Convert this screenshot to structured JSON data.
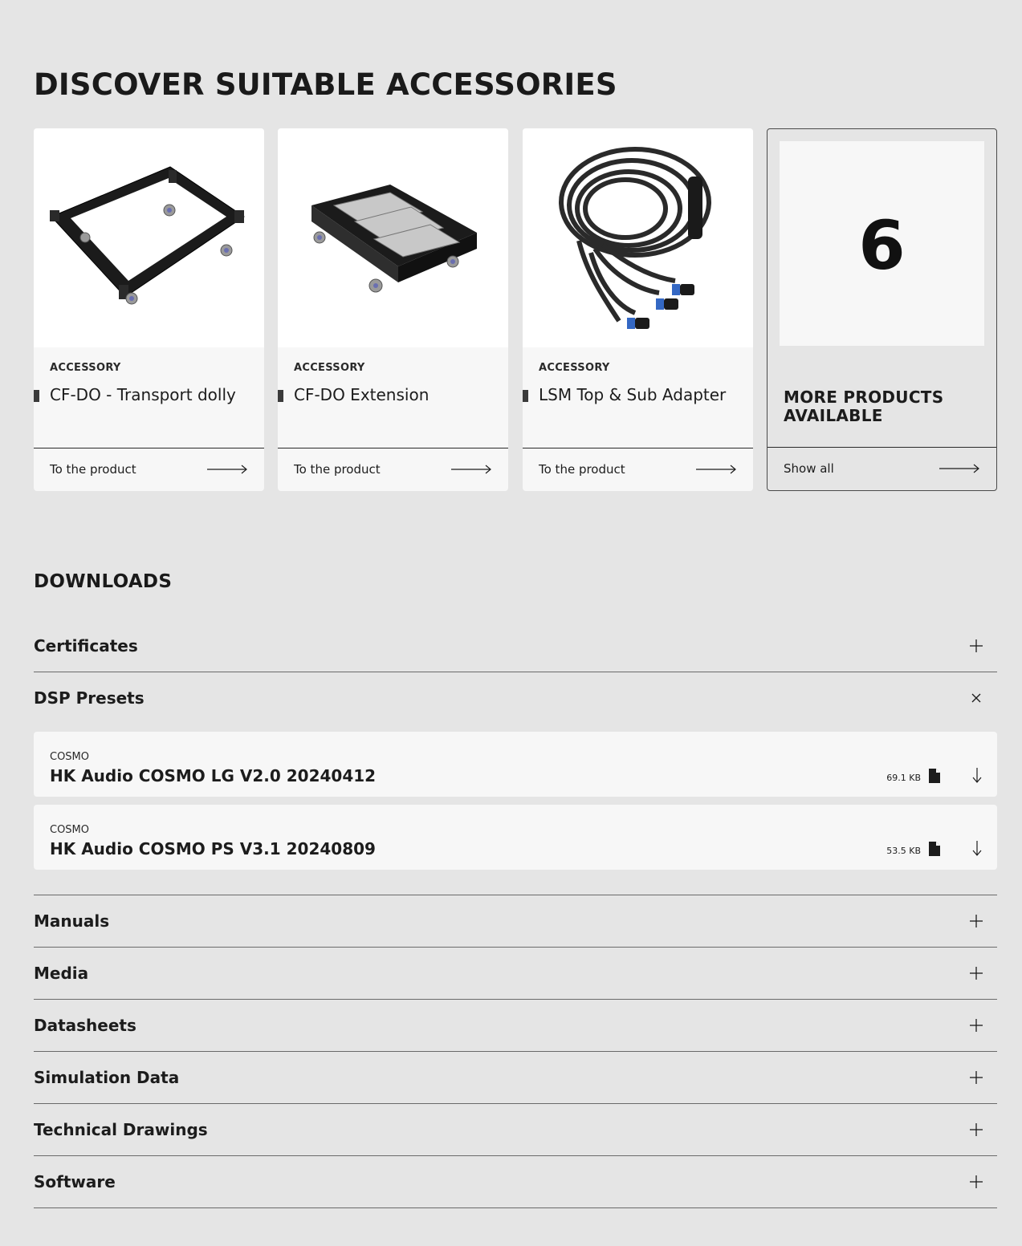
{
  "accessories": {
    "title": "DISCOVER SUITABLE ACCESSORIES",
    "cards": [
      {
        "category": "ACCESSORY",
        "name": "CF-DO - Transport dolly",
        "cta": "To the product"
      },
      {
        "category": "ACCESSORY",
        "name": "CF-DO Extension",
        "cta": "To the product"
      },
      {
        "category": "ACCESSORY",
        "name": "LSM Top & Sub Adapter",
        "cta": "To the product"
      }
    ],
    "more": {
      "count": "6",
      "text": "MORE PRODUCTS AVAILABLE",
      "cta": "Show all"
    }
  },
  "downloads": {
    "title": "DOWNLOADS",
    "sections": [
      {
        "label": "Certificates",
        "state": "collapsed"
      },
      {
        "label": "DSP Presets",
        "state": "expanded"
      },
      {
        "label": "Manuals",
        "state": "collapsed"
      },
      {
        "label": "Media",
        "state": "collapsed"
      },
      {
        "label": "Datasheets",
        "state": "collapsed"
      },
      {
        "label": "Simulation Data",
        "state": "collapsed"
      },
      {
        "label": "Technical Drawings",
        "state": "collapsed"
      },
      {
        "label": "Software",
        "state": "collapsed"
      }
    ],
    "dsp_items": [
      {
        "category": "COSMO",
        "name": "HK Audio COSMO LG V2.0 20240412",
        "size": "69.1 KB"
      },
      {
        "category": "COSMO",
        "name": "HK Audio COSMO PS V3.1 20240809",
        "size": "53.5 KB"
      }
    ]
  }
}
